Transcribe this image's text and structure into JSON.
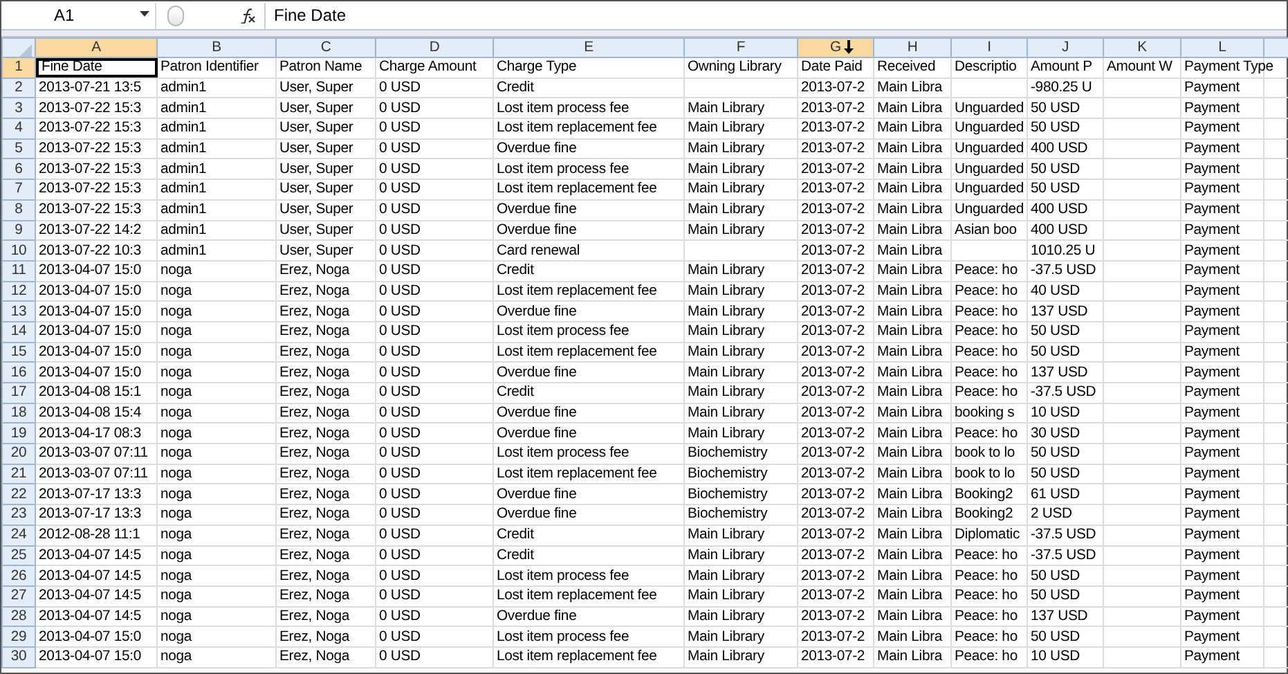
{
  "name_box": "A1",
  "formula_bar": "Fine Date",
  "columns": [
    {
      "label": "A",
      "selected": true
    },
    {
      "label": "B",
      "selected": false
    },
    {
      "label": "C",
      "selected": false
    },
    {
      "label": "D",
      "selected": false
    },
    {
      "label": "E",
      "selected": false
    },
    {
      "label": "F",
      "selected": false
    },
    {
      "label": "G",
      "selected": true
    },
    {
      "label": "H",
      "selected": false
    },
    {
      "label": "I",
      "selected": false
    },
    {
      "label": "J",
      "selected": false
    },
    {
      "label": "K",
      "selected": false
    },
    {
      "label": "L",
      "selected": false
    }
  ],
  "rows": [
    {
      "number": "1",
      "selected": true,
      "cells": [
        "Fine Date",
        "Patron Identifier",
        "Patron Name",
        "Charge Amount",
        "Charge Type",
        "Owning Library",
        "Date Paid",
        "Received",
        "Descriptio",
        "Amount P",
        "Amount W",
        "Payment Type"
      ]
    },
    {
      "number": "2",
      "selected": false,
      "cells": [
        "2013-07-21 13:5",
        "admin1",
        "User, Super",
        "0 USD",
        "Credit",
        null,
        "2013-07-2",
        "Main Libra",
        null,
        "-980.25 U",
        null,
        "Payment"
      ]
    },
    {
      "number": "3",
      "selected": false,
      "cells": [
        "2013-07-22 15:3",
        "admin1",
        "User, Super",
        "0 USD",
        "Lost item process fee",
        "Main Library",
        "2013-07-2",
        "Main Libra",
        "Unguarded",
        "50 USD",
        null,
        "Payment"
      ]
    },
    {
      "number": "4",
      "selected": false,
      "cells": [
        "2013-07-22 15:3",
        "admin1",
        "User, Super",
        "0 USD",
        "Lost item replacement fee",
        "Main Library",
        "2013-07-2",
        "Main Libra",
        "Unguarded",
        "50 USD",
        null,
        "Payment"
      ]
    },
    {
      "number": "5",
      "selected": false,
      "cells": [
        "2013-07-22 15:3",
        "admin1",
        "User, Super",
        "0 USD",
        "Overdue fine",
        "Main Library",
        "2013-07-2",
        "Main Libra",
        "Unguarded",
        "400 USD",
        null,
        "Payment"
      ]
    },
    {
      "number": "6",
      "selected": false,
      "cells": [
        "2013-07-22 15:3",
        "admin1",
        "User, Super",
        "0 USD",
        "Lost item process fee",
        "Main Library",
        "2013-07-2",
        "Main Libra",
        "Unguarded",
        "50 USD",
        null,
        "Payment"
      ]
    },
    {
      "number": "7",
      "selected": false,
      "cells": [
        "2013-07-22 15:3",
        "admin1",
        "User, Super",
        "0 USD",
        "Lost item replacement fee",
        "Main Library",
        "2013-07-2",
        "Main Libra",
        "Unguarded",
        "50 USD",
        null,
        "Payment"
      ]
    },
    {
      "number": "8",
      "selected": false,
      "cells": [
        "2013-07-22 15:3",
        "admin1",
        "User, Super",
        "0 USD",
        "Overdue fine",
        "Main Library",
        "2013-07-2",
        "Main Libra",
        "Unguarded",
        "400 USD",
        null,
        "Payment"
      ]
    },
    {
      "number": "9",
      "selected": false,
      "cells": [
        "2013-07-22 14:2",
        "admin1",
        "User, Super",
        "0 USD",
        "Overdue fine",
        "Main Library",
        "2013-07-2",
        "Main Libra",
        "Asian boo",
        "400 USD",
        null,
        "Payment"
      ]
    },
    {
      "number": "10",
      "selected": false,
      "cells": [
        "2013-07-22 10:3",
        "admin1",
        "User, Super",
        "0 USD",
        "Card renewal",
        null,
        "2013-07-2",
        "Main Libra",
        null,
        "1010.25 U",
        null,
        "Payment"
      ]
    },
    {
      "number": "11",
      "selected": false,
      "cells": [
        "2013-04-07 15:0",
        "noga",
        "Erez, Noga",
        "0 USD",
        "Credit",
        "Main Library",
        "2013-07-2",
        "Main Libra",
        "Peace: ho",
        "-37.5 USD",
        null,
        "Payment"
      ]
    },
    {
      "number": "12",
      "selected": false,
      "cells": [
        "2013-04-07 15:0",
        "noga",
        "Erez, Noga",
        "0 USD",
        "Lost item replacement fee",
        "Main Library",
        "2013-07-2",
        "Main Libra",
        "Peace: ho",
        "40 USD",
        null,
        "Payment"
      ]
    },
    {
      "number": "13",
      "selected": false,
      "cells": [
        "2013-04-07 15:0",
        "noga",
        "Erez, Noga",
        "0 USD",
        "Overdue fine",
        "Main Library",
        "2013-07-2",
        "Main Libra",
        "Peace: ho",
        "137 USD",
        null,
        "Payment"
      ]
    },
    {
      "number": "14",
      "selected": false,
      "cells": [
        "2013-04-07 15:0",
        "noga",
        "Erez, Noga",
        "0 USD",
        "Lost item process fee",
        "Main Library",
        "2013-07-2",
        "Main Libra",
        "Peace: ho",
        "50 USD",
        null,
        "Payment"
      ]
    },
    {
      "number": "15",
      "selected": false,
      "cells": [
        "2013-04-07 15:0",
        "noga",
        "Erez, Noga",
        "0 USD",
        "Lost item replacement fee",
        "Main Library",
        "2013-07-2",
        "Main Libra",
        "Peace: ho",
        "50 USD",
        null,
        "Payment"
      ]
    },
    {
      "number": "16",
      "selected": false,
      "cells": [
        "2013-04-07 15:0",
        "noga",
        "Erez, Noga",
        "0 USD",
        "Overdue fine",
        "Main Library",
        "2013-07-2",
        "Main Libra",
        "Peace: ho",
        "137 USD",
        null,
        "Payment"
      ]
    },
    {
      "number": "17",
      "selected": false,
      "cells": [
        "2013-04-08 15:1",
        "noga",
        "Erez, Noga",
        "0 USD",
        "Credit",
        "Main Library",
        "2013-07-2",
        "Main Libra",
        "Peace: ho",
        "-37.5 USD",
        null,
        "Payment"
      ]
    },
    {
      "number": "18",
      "selected": false,
      "cells": [
        "2013-04-08 15:4",
        "noga",
        "Erez, Noga",
        "0 USD",
        "Overdue fine",
        "Main Library",
        "2013-07-2",
        "Main Libra",
        "booking s",
        "10 USD",
        null,
        "Payment"
      ]
    },
    {
      "number": "19",
      "selected": false,
      "cells": [
        "2013-04-17 08:3",
        "noga",
        "Erez, Noga",
        "0 USD",
        "Overdue fine",
        "Main Library",
        "2013-07-2",
        "Main Libra",
        "Peace: ho",
        "30 USD",
        null,
        "Payment"
      ]
    },
    {
      "number": "20",
      "selected": false,
      "cells": [
        "2013-03-07 07:11",
        "noga",
        "Erez, Noga",
        "0 USD",
        "Lost item process fee",
        "Biochemistry",
        "2013-07-2",
        "Main Libra",
        "book to lo",
        "50 USD",
        null,
        "Payment"
      ]
    },
    {
      "number": "21",
      "selected": false,
      "cells": [
        "2013-03-07 07:11",
        "noga",
        "Erez, Noga",
        "0 USD",
        "Lost item replacement fee",
        "Biochemistry",
        "2013-07-2",
        "Main Libra",
        "book to lo",
        "50 USD",
        null,
        "Payment"
      ]
    },
    {
      "number": "22",
      "selected": false,
      "cells": [
        "2013-07-17 13:3",
        "noga",
        "Erez, Noga",
        "0 USD",
        "Overdue fine",
        "Biochemistry",
        "2013-07-2",
        "Main Libra",
        "Booking2",
        "61 USD",
        null,
        "Payment"
      ]
    },
    {
      "number": "23",
      "selected": false,
      "cells": [
        "2013-07-17 13:3",
        "noga",
        "Erez, Noga",
        "0 USD",
        "Overdue fine",
        "Biochemistry",
        "2013-07-2",
        "Main Libra",
        "Booking2",
        "2 USD",
        null,
        "Payment"
      ]
    },
    {
      "number": "24",
      "selected": false,
      "cells": [
        "2012-08-28 11:1",
        "noga",
        "Erez, Noga",
        "0 USD",
        "Credit",
        "Main Library",
        "2013-07-2",
        "Main Libra",
        "Diplomatic",
        "-37.5 USD",
        null,
        "Payment"
      ]
    },
    {
      "number": "25",
      "selected": false,
      "cells": [
        "2013-04-07 14:5",
        "noga",
        "Erez, Noga",
        "0 USD",
        "Credit",
        "Main Library",
        "2013-07-2",
        "Main Libra",
        "Peace: ho",
        "-37.5 USD",
        null,
        "Payment"
      ]
    },
    {
      "number": "26",
      "selected": false,
      "cells": [
        "2013-04-07 14:5",
        "noga",
        "Erez, Noga",
        "0 USD",
        "Lost item process fee",
        "Main Library",
        "2013-07-2",
        "Main Libra",
        "Peace: ho",
        "50 USD",
        null,
        "Payment"
      ]
    },
    {
      "number": "27",
      "selected": false,
      "cells": [
        "2013-04-07 14:5",
        "noga",
        "Erez, Noga",
        "0 USD",
        "Lost item replacement fee",
        "Main Library",
        "2013-07-2",
        "Main Libra",
        "Peace: ho",
        "50 USD",
        null,
        "Payment"
      ]
    },
    {
      "number": "28",
      "selected": false,
      "cells": [
        "2013-04-07 14:5",
        "noga",
        "Erez, Noga",
        "0 USD",
        "Overdue fine",
        "Main Library",
        "2013-07-2",
        "Main Libra",
        "Peace: ho",
        "137 USD",
        null,
        "Payment"
      ]
    },
    {
      "number": "29",
      "selected": false,
      "cells": [
        "2013-04-07 15:0",
        "noga",
        "Erez, Noga",
        "0 USD",
        "Lost item process fee",
        "Main Library",
        "2013-07-2",
        "Main Libra",
        "Peace: ho",
        "50 USD",
        null,
        "Payment"
      ]
    },
    {
      "number": "30",
      "selected": false,
      "cells": [
        "2013-04-07 15:0",
        "noga",
        "Erez, Noga",
        "0 USD",
        "Lost item replacement fee",
        "Main Library",
        "2013-07-2",
        "Main Libra",
        "Peace: ho",
        "10 USD",
        null,
        "Payment"
      ]
    }
  ]
}
